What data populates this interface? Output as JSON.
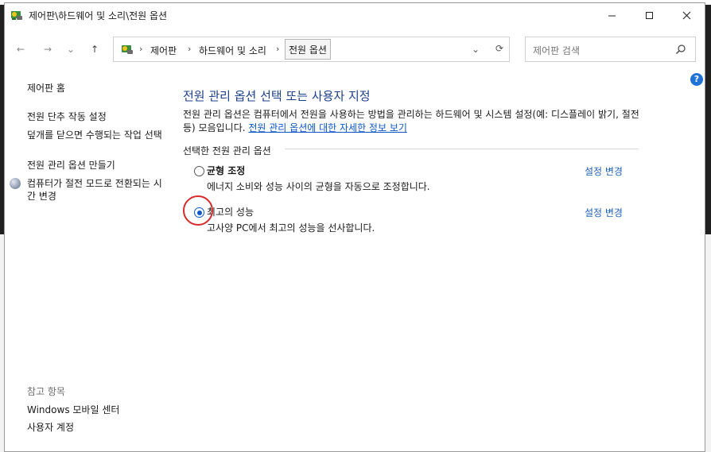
{
  "window": {
    "title": "제어판\\하드웨어 및 소리\\전원 옵션",
    "minimize_label": "—",
    "maximize_label": "☐",
    "close_label": "✕"
  },
  "nav": {
    "back_icon": "←",
    "forward_icon": "→",
    "recent_icon": "⌄",
    "up_icon": "↑"
  },
  "address": {
    "breadcrumbs": [
      "제어판",
      "하드웨어 및 소리"
    ],
    "current": "전원 옵션",
    "separator": "›",
    "dropdown_icon": "⌄",
    "refresh_icon": "⟳"
  },
  "search": {
    "placeholder": "제어판 검색",
    "icon": "⚲"
  },
  "help": {
    "label": "?"
  },
  "sidebar": {
    "home": "제어판 홈",
    "links": [
      "전원 단추 작동 설정",
      "덮개를 닫으면 수행되는 작업 선택",
      "전원 관리 옵션 만들기",
      "컴퓨터가 절전 모드로 전환되는 시간 변경"
    ],
    "see_also_title": "참고 항목",
    "see_also": [
      "Windows 모바일 센터",
      "사용자 계정"
    ]
  },
  "main": {
    "title": "전원 관리 옵션 선택 또는 사용자 지정",
    "description": "전원 관리 옵션은 컴퓨터에서 전원을 사용하는 방법을 관리하는 하드웨어 및 시스템 설정(예: 디스플레이 밝기, 절전 등) 모음입니다. ",
    "description_link": "전원 관리 옵션에 대한 자세한 정보 보기",
    "section_label": "선택한 전원 관리 옵션",
    "plans": [
      {
        "name": "균형 조정",
        "description": "에너지 소비와 성능 사이의 균형을 자동으로 조정합니다.",
        "selected": false,
        "change_label": "설정 변경"
      },
      {
        "name": "최고의 성능",
        "description": "고사양 PC에서 최고의 성능을 선사합니다.",
        "selected": true,
        "change_label": "설정 변경"
      }
    ]
  },
  "colors": {
    "title_blue": "#1c3f8c",
    "link_blue": "#0b57c9",
    "highlight_red": "#d52b2b"
  }
}
